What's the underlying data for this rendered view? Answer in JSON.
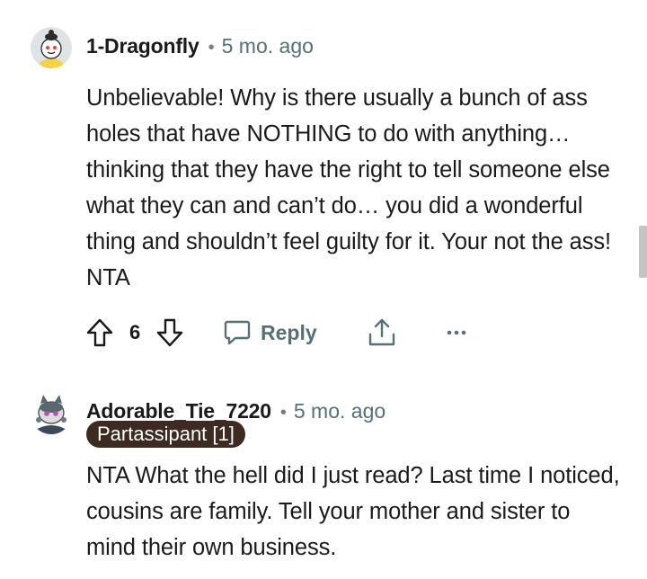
{
  "comments": [
    {
      "username": "1-Dragonfly",
      "time": "5 mo. ago",
      "body": "Unbelievable! Why is there usually a bunch of ass holes that have NOTHING to do with anything… thinking that they have the right to tell someone else what they can and can’t do… you did a wonderful thing and shouldn’t feel guilty for it. Your not the ass! NTA",
      "votes": "6",
      "reply_label": "Reply"
    },
    {
      "username": "Adorable_Tie_7220",
      "time": "5 mo. ago",
      "flair": "Partassipant [1]",
      "body": "NTA What the hell did I just read? Last time I noticed, cousins are family. Tell your mother and sister to mind their own business."
    }
  ],
  "separator": "•",
  "icons": {
    "upvote": "arrow-up-outline",
    "downvote": "arrow-down-outline",
    "reply": "speech-bubble",
    "share": "share-upload",
    "more": "ellipsis",
    "avatar_1": "snoo-avatar",
    "avatar_2": "snoo-avatar-cat"
  },
  "colors": {
    "text": "#1a1a1b",
    "meta": "#576f76",
    "flair_bg": "#3d2a21",
    "flair_text": "#ffffff"
  }
}
